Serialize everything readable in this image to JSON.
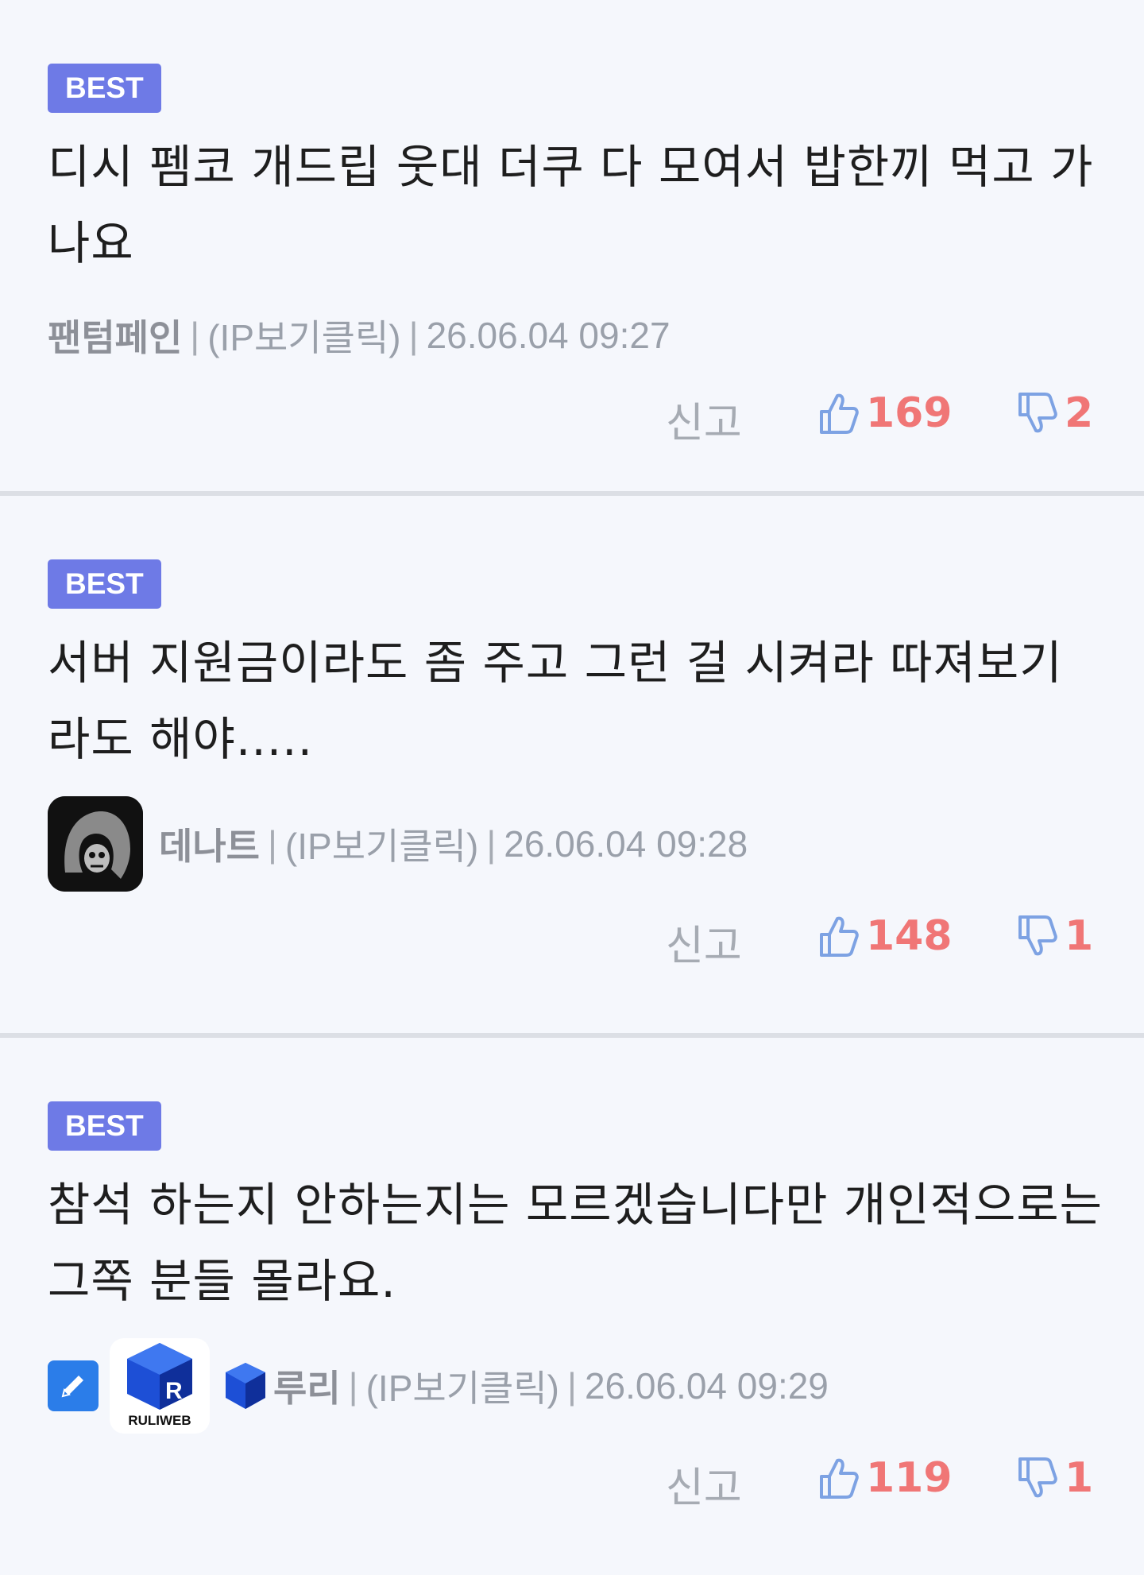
{
  "comments": [
    {
      "badge": "BEST",
      "text": "디시 펨코 개드립 웃대 더쿠 다 모여서 밥한끼 먹고 가나요",
      "nickname": "팬텀페인",
      "ip_label": "(IP보기클릭)",
      "timestamp": "26.06.04 09:27",
      "report_label": "신고",
      "likes": "169",
      "dislikes": "2"
    },
    {
      "badge": "BEST",
      "text": "서버 지원금이라도 좀 주고 그런 걸 시켜라 따져보기라도 해야.....",
      "nickname": "데나트",
      "ip_label": "(IP보기클릭)",
      "timestamp": "26.06.04 09:28",
      "report_label": "신고",
      "likes": "148",
      "dislikes": "1"
    },
    {
      "badge": "BEST",
      "text": "참석 하는지 안하는지는 모르겠습니다만 개인적으로는 그쪽 분들 몰라요.",
      "nickname": "루리",
      "ip_label": "(IP보기클릭)",
      "timestamp": "26.06.04 09:29",
      "report_label": "신고",
      "likes": "119",
      "dislikes": "1",
      "avatar_logo_text": "RULIWEB"
    }
  ],
  "separator": "|",
  "colors": {
    "badge": "#6e7ae6",
    "count": "#f07676",
    "thumb": "#7da2e3",
    "muted": "#a6abb3",
    "divider": "#dcdfe5",
    "background": "#f5f7fc"
  },
  "icons": {
    "like": "thumbs-up-icon",
    "dislike": "thumbs-down-icon",
    "edit": "pencil-icon"
  }
}
